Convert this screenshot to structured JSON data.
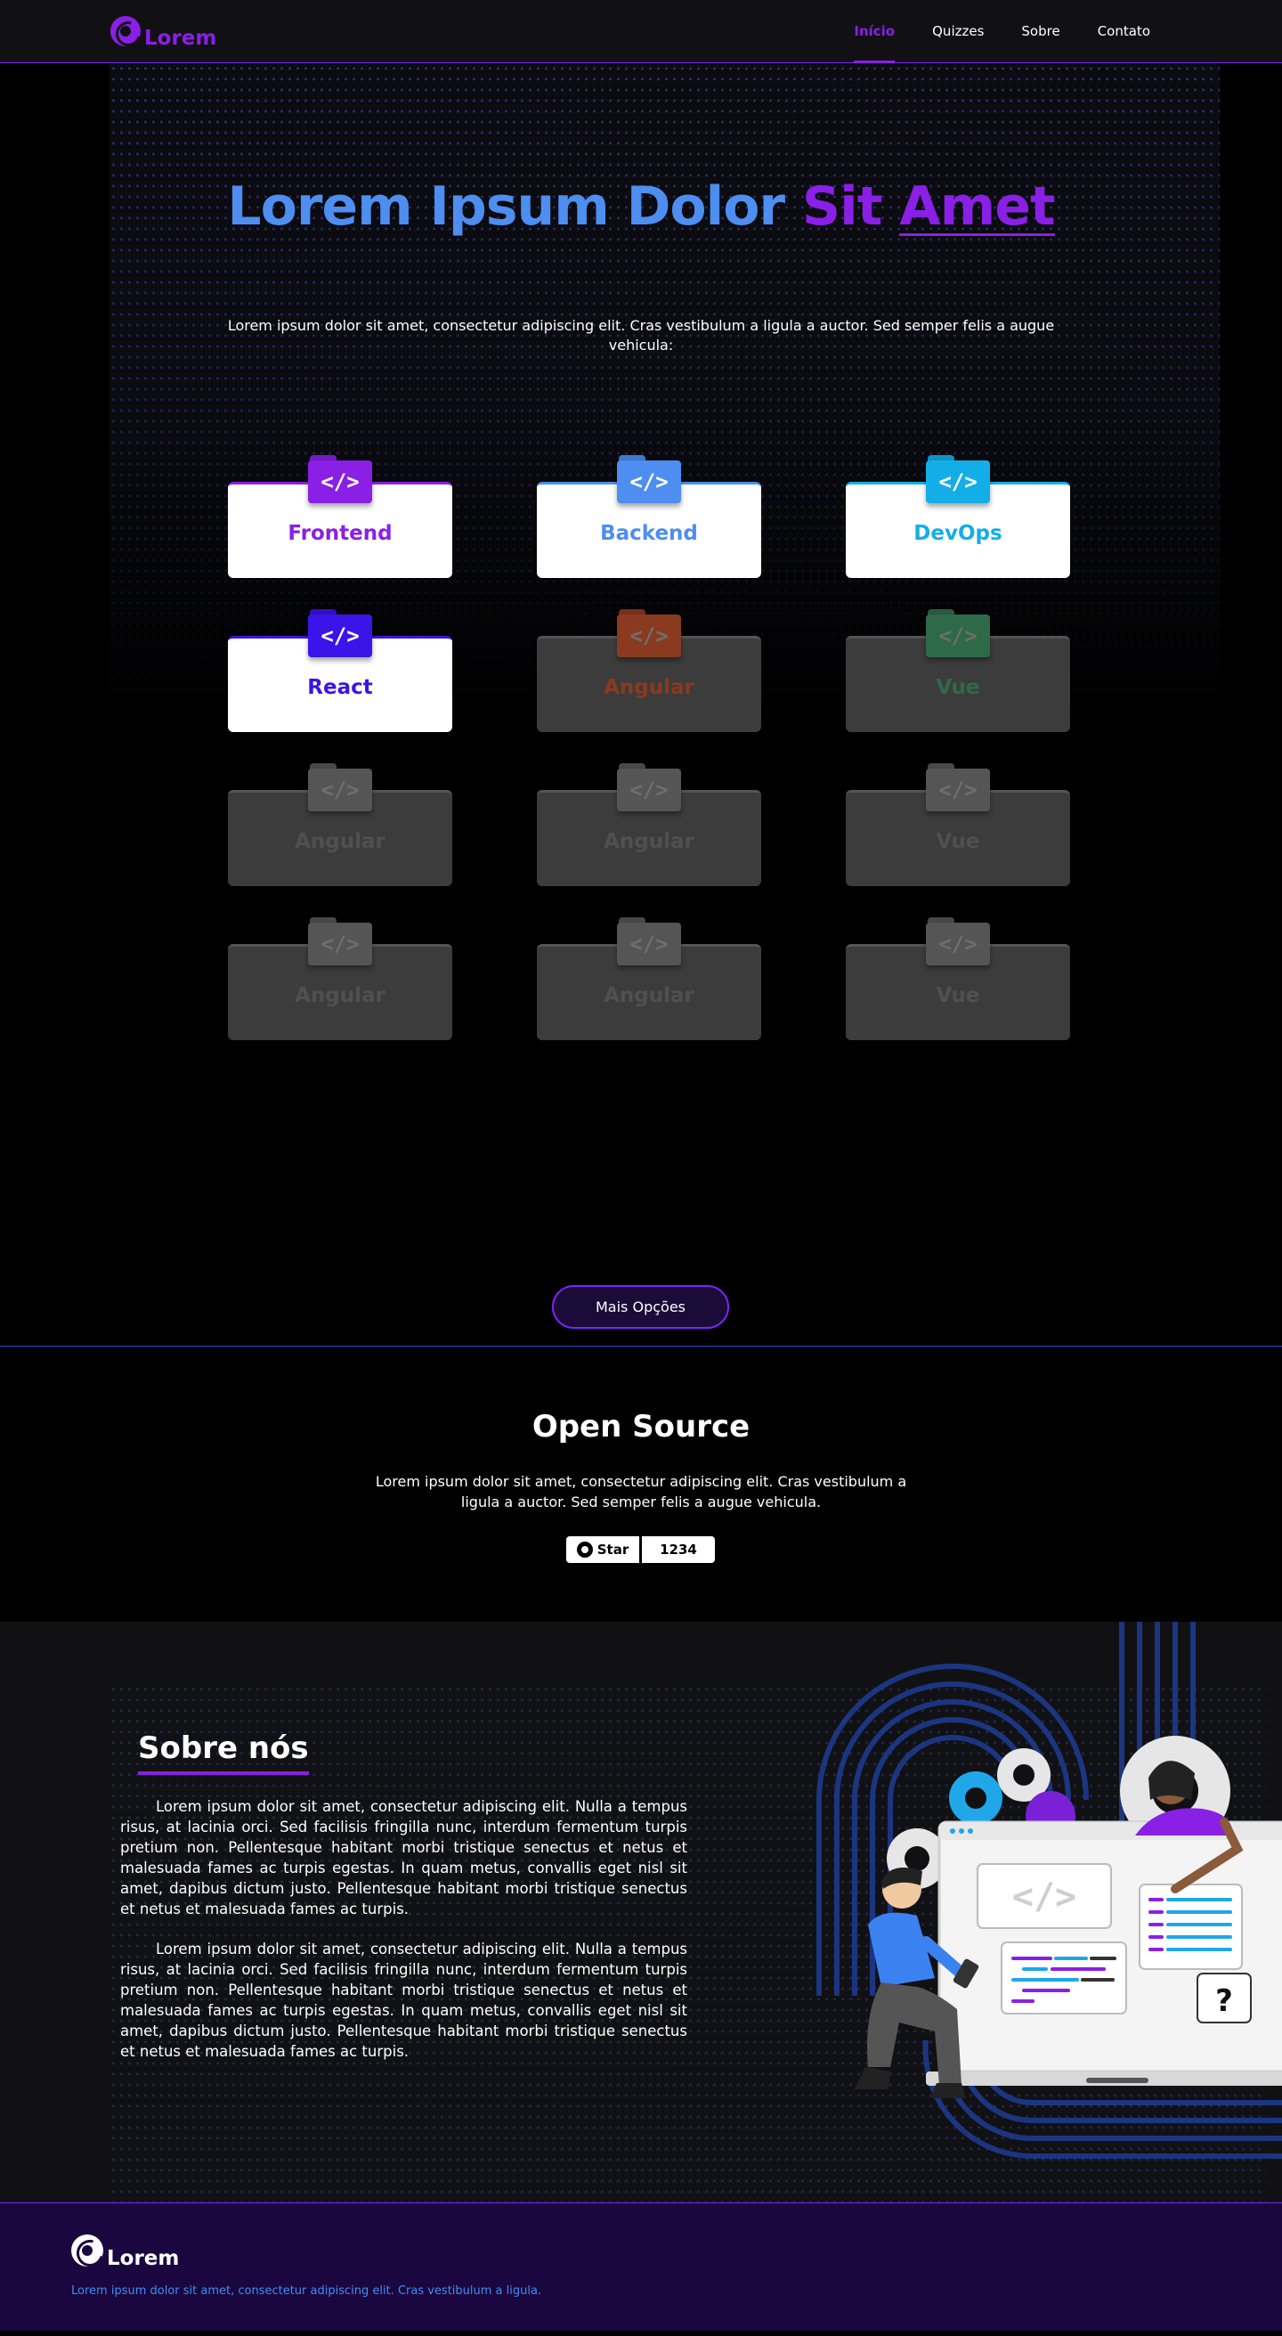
{
  "navbar": {
    "brand": "Lorem",
    "links": [
      "Início",
      "Quizzes",
      "Sobre",
      "Contato"
    ]
  },
  "hero": {
    "title_part1": "Lorem Ipsum Dolor",
    "title_part2": "Sit",
    "title_part3": "Amet",
    "subtitle": "Lorem ipsum dolor sit amet, consectetur adipiscing elit. Cras vestibulum a ligula a auctor. Sed semper felis a augue vehicula:",
    "folder_icon_text": "</>",
    "cards": [
      {
        "label": "Frontend",
        "color": "#8a1fe6",
        "state": "active"
      },
      {
        "label": "Backend",
        "color": "#4d8ef0",
        "state": "active"
      },
      {
        "label": "DevOps",
        "color": "#13aee8",
        "state": "active"
      },
      {
        "label": "React",
        "color": "#3a14e8",
        "state": "active"
      },
      {
        "label": "Angular",
        "color": "#8a3a1e",
        "state": "disabled"
      },
      {
        "label": "Vue",
        "color": "#2f6a48",
        "state": "disabled"
      },
      {
        "label": "Angular",
        "color": "#555555",
        "state": "disabled"
      },
      {
        "label": "Angular",
        "color": "#555555",
        "state": "disabled"
      },
      {
        "label": "Vue",
        "color": "#555555",
        "state": "disabled"
      },
      {
        "label": "Angular",
        "color": "#555555",
        "state": "disabled"
      },
      {
        "label": "Angular",
        "color": "#555555",
        "state": "disabled"
      },
      {
        "label": "Vue",
        "color": "#555555",
        "state": "disabled"
      }
    ],
    "more_button": "Mais Opções"
  },
  "open_source": {
    "title": "Open Source",
    "text": "Lorem ipsum dolor sit amet, consectetur adipiscing elit. Cras vestibulum a ligula a auctor. Sed semper felis a augue vehicula.",
    "star_label": "Star",
    "star_count": "1234"
  },
  "about": {
    "title": "Sobre nós",
    "paragraph1": "Lorem ipsum dolor sit amet, consectetur adipiscing elit. Nulla a tempus risus, at lacinia orci. Sed facilisis fringilla nunc, interdum fermentum turpis pretium non. Pellentesque habitant morbi tristique senectus et netus et malesuada fames ac turpis egestas. In quam metus, convallis eget nisl sit amet, dapibus dictum justo.  Pellentesque habitant morbi tristique senectus et netus et malesuada fames ac turpis.",
    "paragraph2": "Lorem ipsum dolor sit amet, consectetur adipiscing elit. Nulla a tempus risus, at lacinia orci. Sed facilisis fringilla nunc, interdum fermentum turpis pretium non. Pellentesque habitant morbi tristique senectus et netus et malesuada fames ac turpis egestas. In quam metus, convallis eget nisl sit amet, dapibus dictum justo.  Pellentesque habitant morbi tristique senectus et netus et malesuada fames ac turpis.",
    "illustration_code": "</>",
    "illustration_question": "?"
  },
  "footer": {
    "brand": "Lorem",
    "text": "Lorem ipsum dolor sit amet, consectetur adipiscing elit. Cras vestibulum a ligula."
  },
  "colors": {
    "accent_purple": "#8a1fe6",
    "accent_blue": "#4d8ef0",
    "footer_bg": "#1a073f"
  }
}
